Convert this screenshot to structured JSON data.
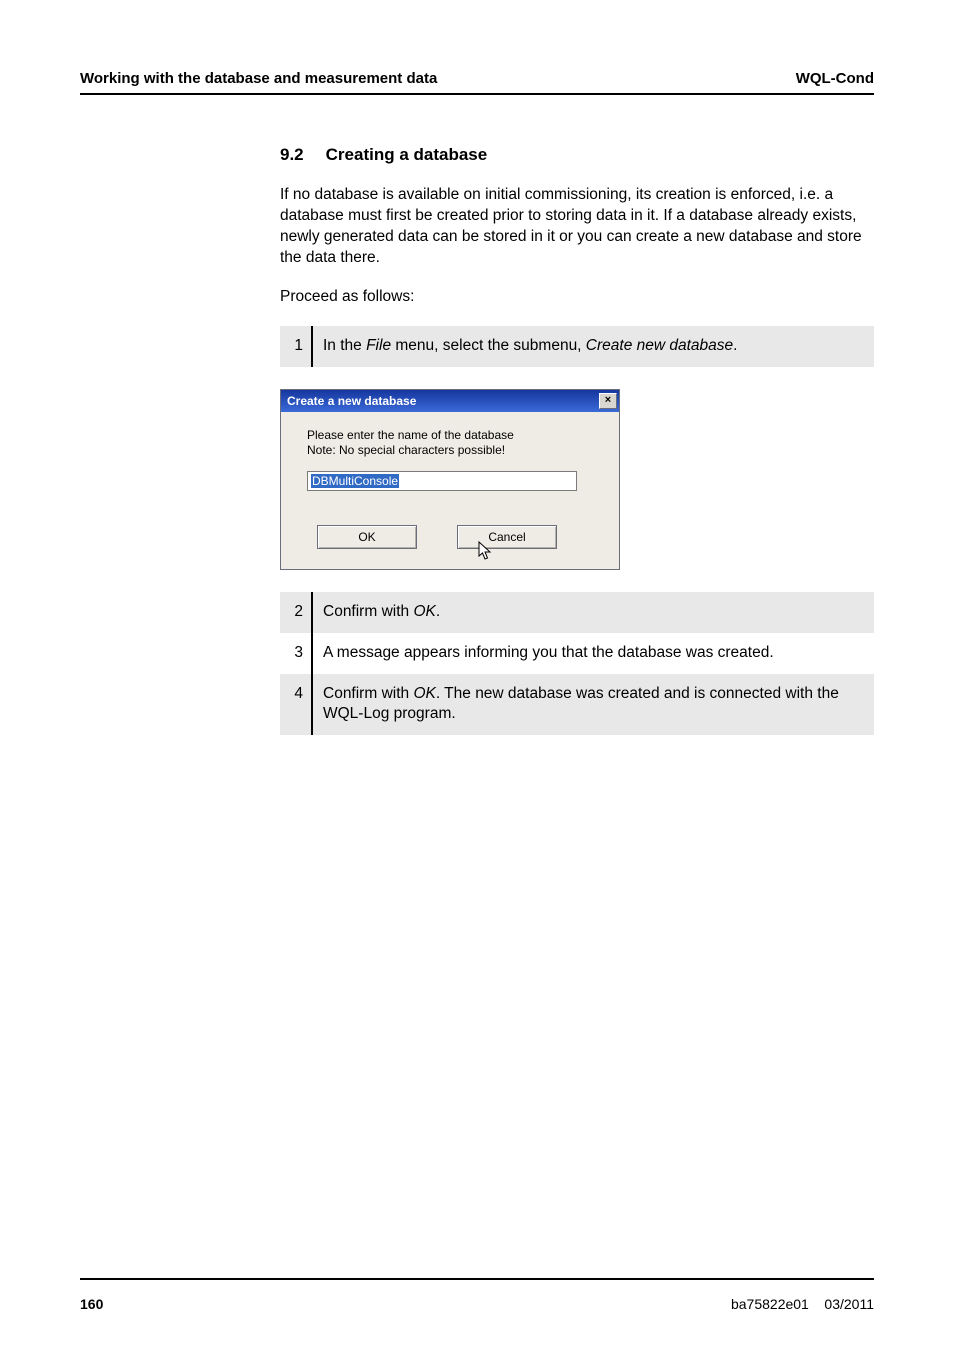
{
  "header": {
    "left": "Working with the database and measurement data",
    "right": "WQL-Cond"
  },
  "section": {
    "number": "9.2",
    "title": "Creating a database"
  },
  "paragraphs": {
    "p1": "If no database is available on initial commissioning, its creation is enforced, i.e. a database must first be created prior to storing data in it. If a database already exists, newly generated data can be stored in it or you can create a new database and store the data there.",
    "p2": "Proceed as follows:"
  },
  "steps": {
    "s1": {
      "n": "1",
      "pre": "In the ",
      "em1": "File",
      "mid": " menu, select the submenu, ",
      "em2": "Create new database",
      "post": "."
    },
    "s2": {
      "n": "2",
      "pre": "Confirm with ",
      "em": "OK",
      "post": "."
    },
    "s3": {
      "n": "3",
      "text": "A message appears informing you that the database was created."
    },
    "s4": {
      "n": "4",
      "pre": "Confirm with ",
      "em": "OK",
      "post": ". The new database was created and is connected with the WQL-Log program."
    }
  },
  "dialog": {
    "title": "Create a new database",
    "close_glyph": "×",
    "msg_line1": "Please enter the name of the database",
    "msg_line2": "Note: No special characters possible!",
    "input_value": "DBMultiConsole",
    "ok_label": "OK",
    "cancel_label": "Cancel"
  },
  "footer": {
    "page": "160",
    "docid": "ba75822e01",
    "date": "03/2011"
  }
}
